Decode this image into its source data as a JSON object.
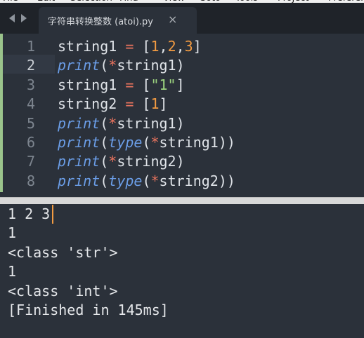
{
  "menu": {
    "items": [
      "File",
      "Edit",
      "Selection",
      "Find",
      "View",
      "Goto",
      "Tools",
      "Project",
      "Preferences"
    ]
  },
  "tabs": [
    {
      "title": "字符串转换整数 (atoi).py",
      "close_glyph": "×",
      "active": true
    }
  ],
  "icons": {
    "nav_back": "triangle-left-icon",
    "nav_forward": "triangle-right-icon",
    "close": "close-icon"
  },
  "colors": {
    "background": "#2b313a",
    "keyword": "#6b9ee8",
    "operator": "#e8735e",
    "number": "#f29b42",
    "string": "#9cd37f",
    "text": "#dfe3e8",
    "line_number": "#7d858f",
    "modified_marker": "#9ac38b"
  },
  "editor": {
    "current_line": 2,
    "lines": [
      {
        "num": "1",
        "tokens": [
          {
            "t": "string1 ",
            "c": "punc"
          },
          {
            "t": "=",
            "c": "op"
          },
          {
            "t": " [",
            "c": "punc"
          },
          {
            "t": "1",
            "c": "num"
          },
          {
            "t": ",",
            "c": "punc"
          },
          {
            "t": "2",
            "c": "num"
          },
          {
            "t": ",",
            "c": "punc"
          },
          {
            "t": "3",
            "c": "num"
          },
          {
            "t": "]",
            "c": "punc"
          }
        ]
      },
      {
        "num": "2",
        "tokens": [
          {
            "t": "print",
            "c": "kw"
          },
          {
            "t": "(",
            "c": "punc"
          },
          {
            "t": "*",
            "c": "op"
          },
          {
            "t": "string1)",
            "c": "punc"
          }
        ]
      },
      {
        "num": "3",
        "tokens": [
          {
            "t": "string1 ",
            "c": "punc"
          },
          {
            "t": "=",
            "c": "op"
          },
          {
            "t": " [",
            "c": "punc"
          },
          {
            "t": "\"1\"",
            "c": "str"
          },
          {
            "t": "]",
            "c": "punc"
          }
        ]
      },
      {
        "num": "4",
        "tokens": [
          {
            "t": "string2 ",
            "c": "punc"
          },
          {
            "t": "=",
            "c": "op"
          },
          {
            "t": " [",
            "c": "punc"
          },
          {
            "t": "1",
            "c": "num"
          },
          {
            "t": "]",
            "c": "punc"
          }
        ]
      },
      {
        "num": "5",
        "tokens": [
          {
            "t": "print",
            "c": "kw"
          },
          {
            "t": "(",
            "c": "punc"
          },
          {
            "t": "*",
            "c": "op"
          },
          {
            "t": "string1)",
            "c": "punc"
          }
        ]
      },
      {
        "num": "6",
        "tokens": [
          {
            "t": "print",
            "c": "kw"
          },
          {
            "t": "(",
            "c": "punc"
          },
          {
            "t": "type",
            "c": "kw"
          },
          {
            "t": "(",
            "c": "punc"
          },
          {
            "t": "*",
            "c": "op"
          },
          {
            "t": "string1))",
            "c": "punc"
          }
        ]
      },
      {
        "num": "7",
        "tokens": [
          {
            "t": "print",
            "c": "kw"
          },
          {
            "t": "(",
            "c": "punc"
          },
          {
            "t": "*",
            "c": "op"
          },
          {
            "t": "string2)",
            "c": "punc"
          }
        ]
      },
      {
        "num": "8",
        "tokens": [
          {
            "t": "print",
            "c": "kw"
          },
          {
            "t": "(",
            "c": "punc"
          },
          {
            "t": "type",
            "c": "kw"
          },
          {
            "t": "(",
            "c": "punc"
          },
          {
            "t": "*",
            "c": "op"
          },
          {
            "t": "string2))",
            "c": "punc"
          }
        ]
      }
    ]
  },
  "output": {
    "lines": [
      "1 2 3",
      "1",
      "<class 'str'>",
      "1",
      "<class 'int'>",
      "[Finished in 145ms]"
    ]
  }
}
